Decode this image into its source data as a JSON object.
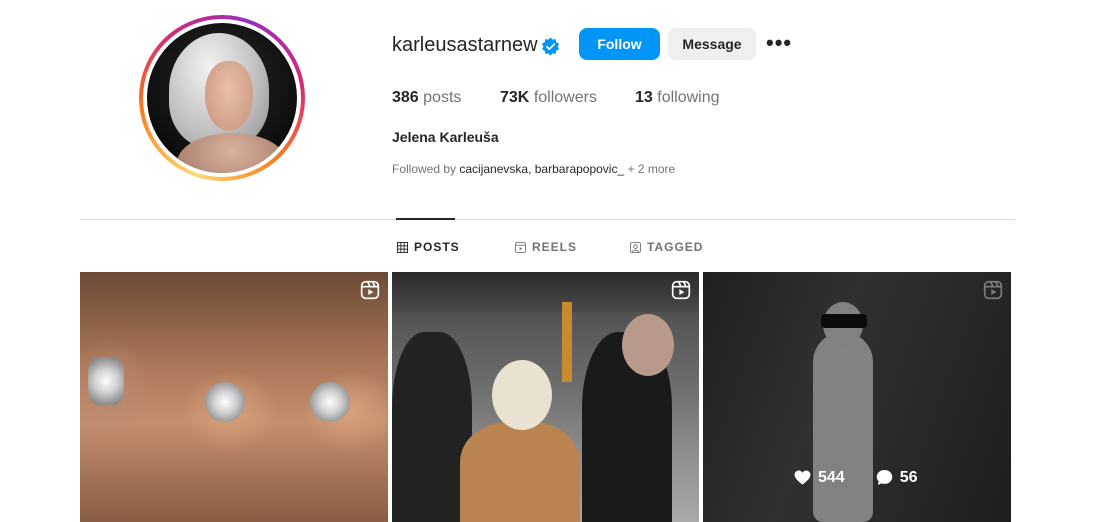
{
  "profile": {
    "username": "karleusastarnew",
    "verified": true,
    "full_name": "Jelena Karleuša",
    "follow_label": "Follow",
    "message_label": "Message",
    "more_label": "•••",
    "accent_color": "#0095f6"
  },
  "stats": {
    "posts_value": "386",
    "posts_label": "posts",
    "followers_value": "73K",
    "followers_label": "followers",
    "following_value": "13",
    "following_label": "following"
  },
  "followed_by": {
    "prefix": "Followed by",
    "user1": "cacijanevska",
    "separator": ", ",
    "user2": "barbarapopovic_",
    "more": " + 2 more"
  },
  "tabs": [
    {
      "label": "POSTS",
      "icon": "grid-icon",
      "active": true
    },
    {
      "label": "REELS",
      "icon": "reels-icon",
      "active": false
    },
    {
      "label": "TAGGED",
      "icon": "tagged-icon",
      "active": false
    }
  ],
  "posts": [
    {
      "type": "reel",
      "icon": "reel-icon"
    },
    {
      "type": "reel",
      "icon": "reel-icon"
    },
    {
      "type": "reel",
      "icon": "reel-icon",
      "hovered": true,
      "likes": "544",
      "comments": "56"
    }
  ]
}
